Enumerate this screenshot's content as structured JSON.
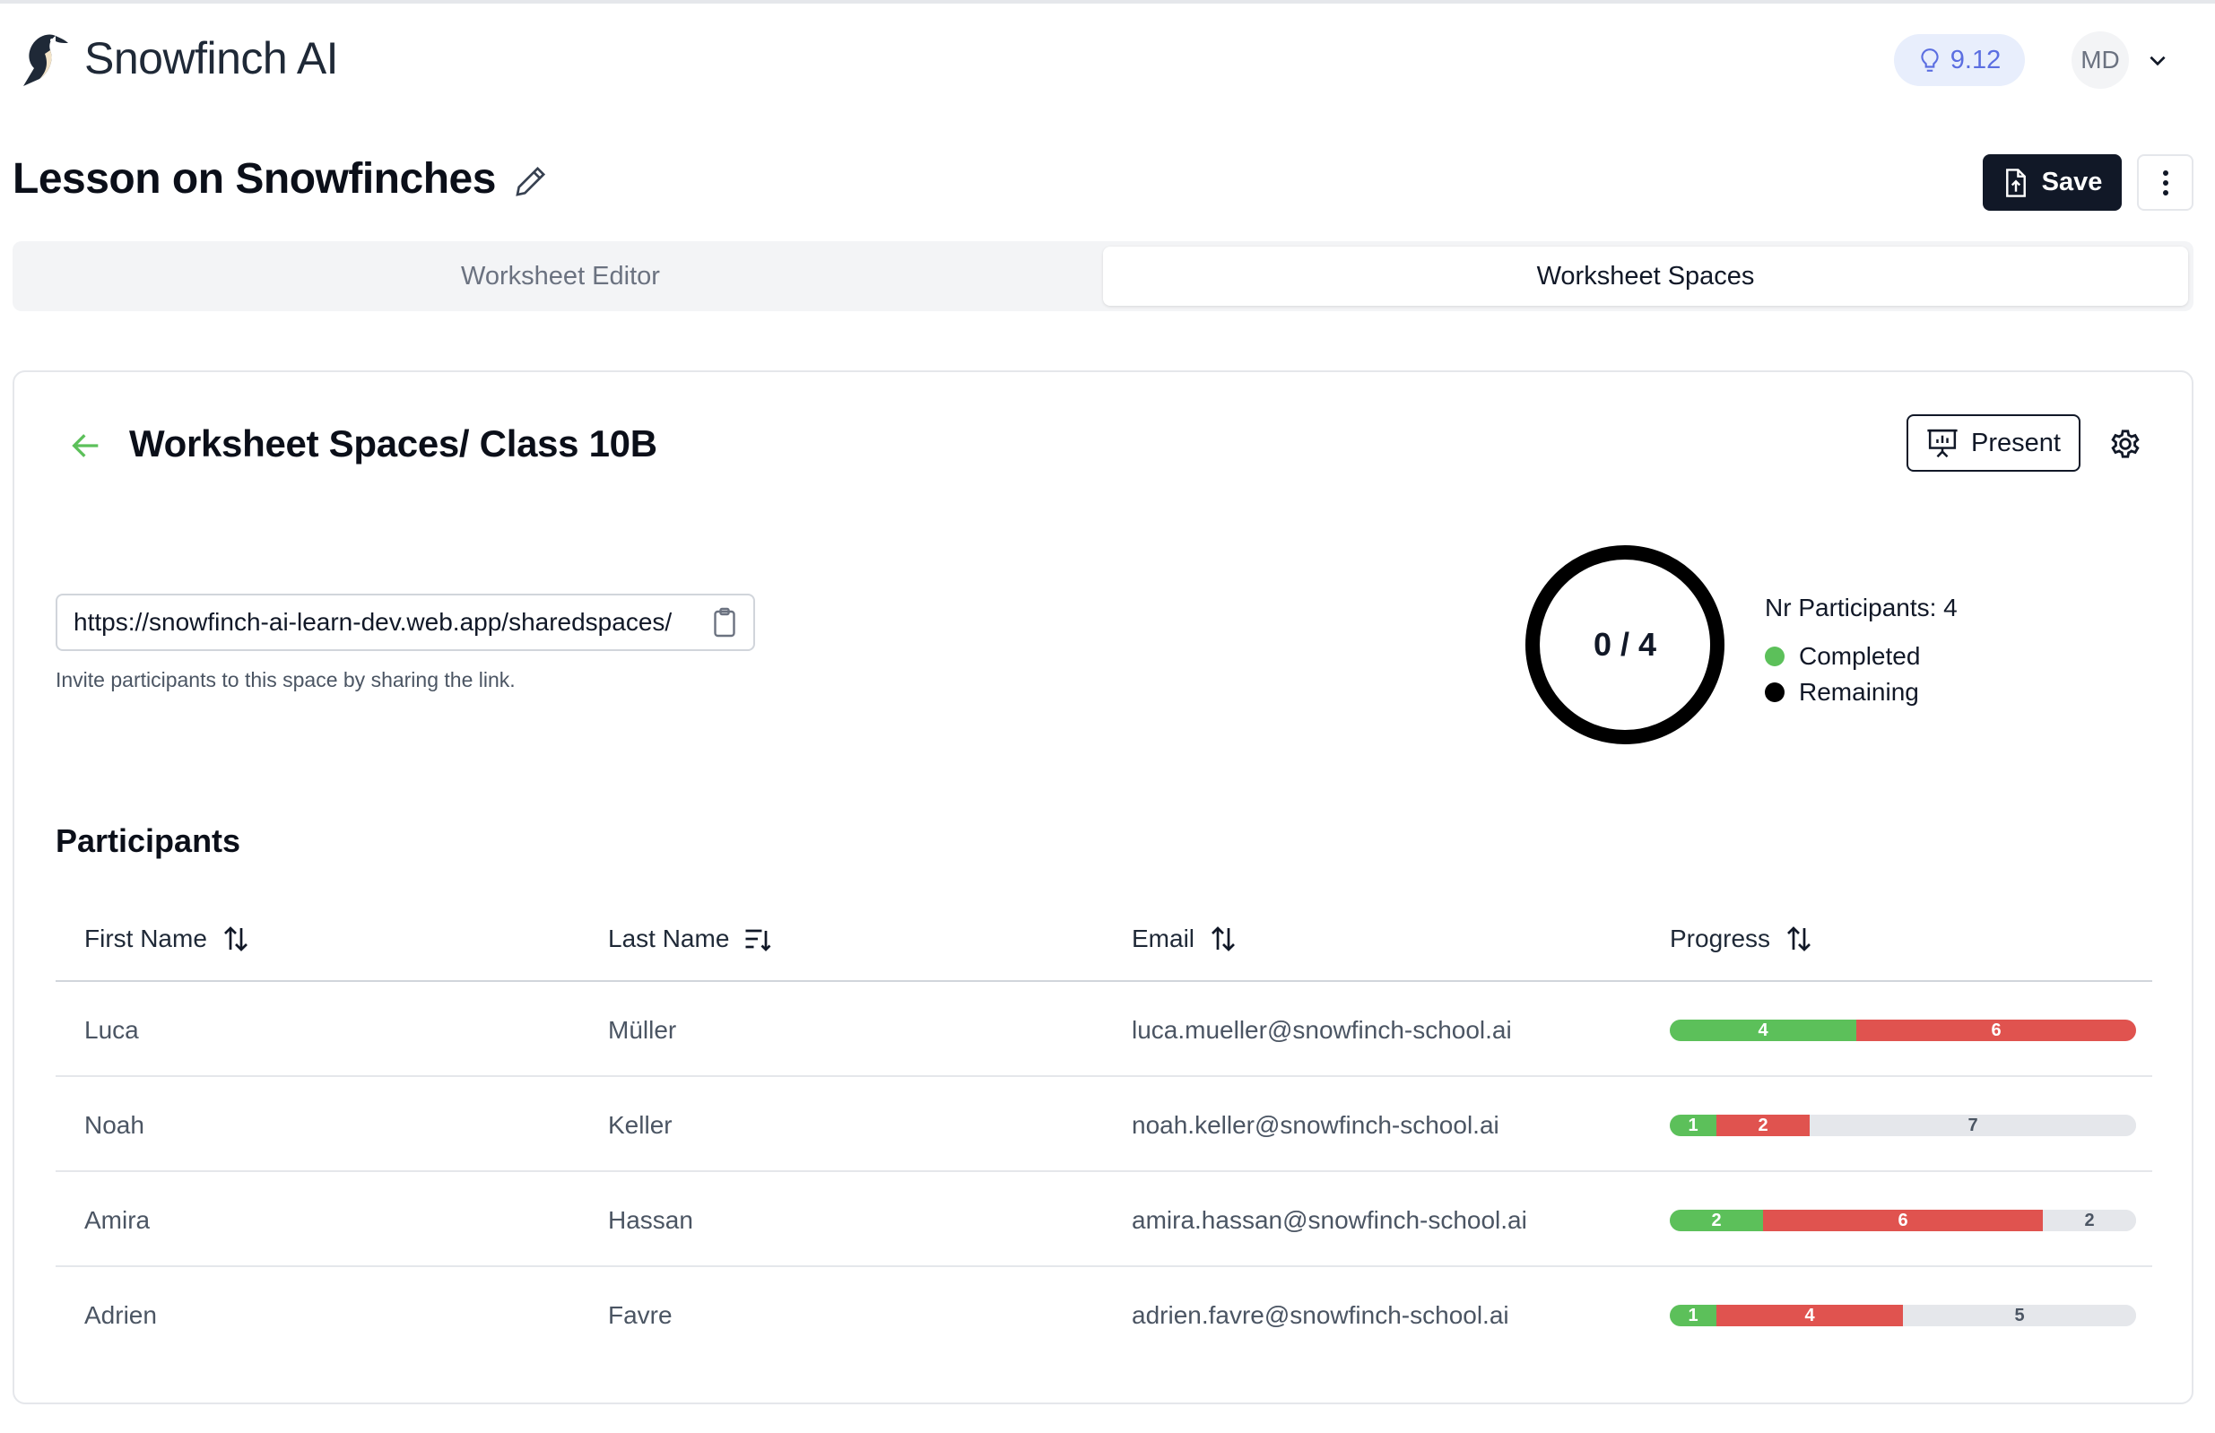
{
  "app": {
    "name": "Snowfinch AI"
  },
  "header": {
    "credits": "9.12",
    "avatar_initials": "MD"
  },
  "lesson": {
    "title": "Lesson on Snowfinches",
    "save_label": "Save"
  },
  "tabs": [
    {
      "label": "Worksheet Editor",
      "active": false
    },
    {
      "label": "Worksheet Spaces",
      "active": true
    }
  ],
  "space": {
    "title": "Worksheet Spaces/ Class 10B",
    "present_label": "Present",
    "share_link": "https://snowfinch-ai-learn-dev.web.app/sharedspaces/",
    "invite_hint": "Invite participants to this space by sharing the link.",
    "completed": 0,
    "total": 4,
    "completion_label": "0 / 4",
    "nr_participants_label": "Nr Participants: 4",
    "legend": [
      {
        "label": "Completed",
        "color": "#5cc05a"
      },
      {
        "label": "Remaining",
        "color": "#000000"
      }
    ]
  },
  "participants": {
    "heading": "Participants",
    "columns": [
      {
        "label": "First Name",
        "sort_icon": "sort-up-down-icon"
      },
      {
        "label": "Last Name",
        "sort_icon": "sort-lines-icon"
      },
      {
        "label": "Email",
        "sort_icon": "sort-up-down-icon"
      },
      {
        "label": "Progress",
        "sort_icon": "sort-up-down-icon"
      }
    ],
    "rows": [
      {
        "first": "Luca",
        "last": "Müller",
        "email": "luca.mueller@snowfinch-school.ai",
        "correct": 4,
        "wrong": 6,
        "open": 0
      },
      {
        "first": "Noah",
        "last": "Keller",
        "email": "noah.keller@snowfinch-school.ai",
        "correct": 1,
        "wrong": 2,
        "open": 7
      },
      {
        "first": "Amira",
        "last": "Hassan",
        "email": "amira.hassan@snowfinch-school.ai",
        "correct": 2,
        "wrong": 6,
        "open": 2
      },
      {
        "first": "Adrien",
        "last": "Favre",
        "email": "adrien.favre@snowfinch-school.ai",
        "correct": 1,
        "wrong": 4,
        "open": 5
      }
    ]
  },
  "colors": {
    "correct": "#5cc05a",
    "wrong": "#e0534f",
    "open": "#e5e7eb",
    "primary": "#111827"
  }
}
